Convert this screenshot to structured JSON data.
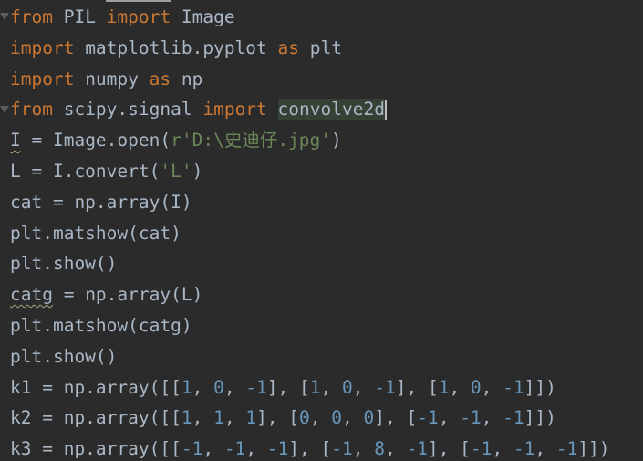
{
  "code": {
    "line1": {
      "kw1": "from",
      "mod": " PIL ",
      "kw2": "import",
      "name": " Image"
    },
    "line2": {
      "kw1": "import",
      "mod": " matplotlib.pyplot ",
      "kw2": "as",
      "alias": " plt"
    },
    "line3": {
      "kw1": "import",
      "mod": " numpy ",
      "kw2": "as",
      "alias": " np"
    },
    "line4": {
      "kw1": "from",
      "mod": " scipy.signal ",
      "kw2": "import",
      "sp": " ",
      "name": "convolve2d"
    },
    "line5": {
      "var": "I",
      "pre": " = Image.open(",
      "str": "r'D:\\史迪仔.jpg'",
      "post": ")"
    },
    "line6": {
      "pre": "L = I.convert(",
      "str": "'L'",
      "post": ")"
    },
    "line7": {
      "text": "cat = np.array(I)"
    },
    "line8": {
      "text": "plt.matshow(cat)"
    },
    "line9": {
      "text": "plt.show()"
    },
    "line10": {
      "var": "catg",
      "post": " = np.array(L)"
    },
    "line11": {
      "text": "plt.matshow(catg)"
    },
    "line12": {
      "text": "plt.show()"
    },
    "line13": {
      "pre": "k1 = np.array([[",
      "n1": "1",
      "s1": ", ",
      "n2": "0",
      "s2": ", ",
      "n3": "-1",
      "s3": "], [",
      "n4": "1",
      "s4": ", ",
      "n5": "0",
      "s5": ", ",
      "n6": "-1",
      "s6": "], [",
      "n7": "1",
      "s7": ", ",
      "n8": "0",
      "s8": ", ",
      "n9": "-1",
      "end": "]])"
    },
    "line14": {
      "pre": "k2 = np.array([[",
      "n1": "1",
      "s1": ", ",
      "n2": "1",
      "s2": ", ",
      "n3": "1",
      "s3": "], [",
      "n4": "0",
      "s4": ", ",
      "n5": "0",
      "s5": ", ",
      "n6": "0",
      "s6": "], [",
      "n7": "-1",
      "s7": ", ",
      "n8": "-1",
      "s8": ", ",
      "n9": "-1",
      "end": "]])"
    },
    "line15": {
      "pre": "k3 = np.array([[",
      "n1": "-1",
      "s1": ", ",
      "n2": "-1",
      "s2": ", ",
      "n3": "-1",
      "s3": "], [",
      "n4": "-1",
      "s4": ", ",
      "n5": "8",
      "s5": ", ",
      "n6": "-1",
      "s6": "], [",
      "n7": "-1",
      "s7": ", ",
      "n8": "-1",
      "s8": ", ",
      "n9": "-1",
      "end": "]])"
    }
  },
  "colors": {
    "background": "#2b2b2b",
    "keyword": "#cc7832",
    "string": "#6a8759",
    "number": "#6897bb",
    "text": "#a9b7c6"
  }
}
